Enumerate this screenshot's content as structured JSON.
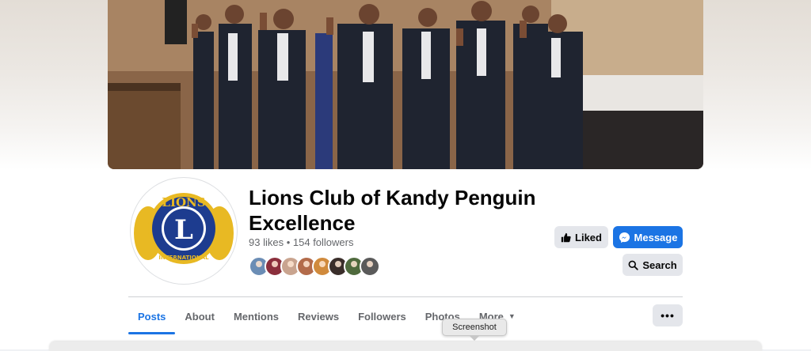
{
  "page": {
    "name": "Lions Club of Kandy Penguin Excellence",
    "likes": "93 likes",
    "separator": "•",
    "followers": "154 followers"
  },
  "logo": {
    "top_text": "LIONS",
    "center_letter": "L",
    "bottom_text": "INTERNATIONAL",
    "colors": {
      "gold": "#e8b923",
      "navy": "#1d3c8f",
      "white": "#ffffff"
    }
  },
  "actions": {
    "liked_label": "Liked",
    "message_label": "Message",
    "search_label": "Search",
    "more_options_label": "•••"
  },
  "tabs": [
    {
      "label": "Posts",
      "active": true
    },
    {
      "label": "About"
    },
    {
      "label": "Mentions"
    },
    {
      "label": "Reviews"
    },
    {
      "label": "Followers"
    },
    {
      "label": "Photos"
    },
    {
      "label": "More",
      "has_dropdown": true
    }
  ],
  "friend_avatars": [
    {
      "color": "#6b8db5"
    },
    {
      "color": "#8b2f3c"
    },
    {
      "color": "#c9a48f"
    },
    {
      "color": "#b36b4a"
    },
    {
      "color": "#d08a3c"
    },
    {
      "color": "#3a2e2a"
    },
    {
      "color": "#4f6a3d"
    },
    {
      "color": "#5a5a5a"
    }
  ],
  "tooltip": {
    "text": "Screenshot"
  },
  "colors": {
    "accent": "#1b74e4",
    "button_gray": "#e4e6eb",
    "muted_text": "#65676b"
  }
}
